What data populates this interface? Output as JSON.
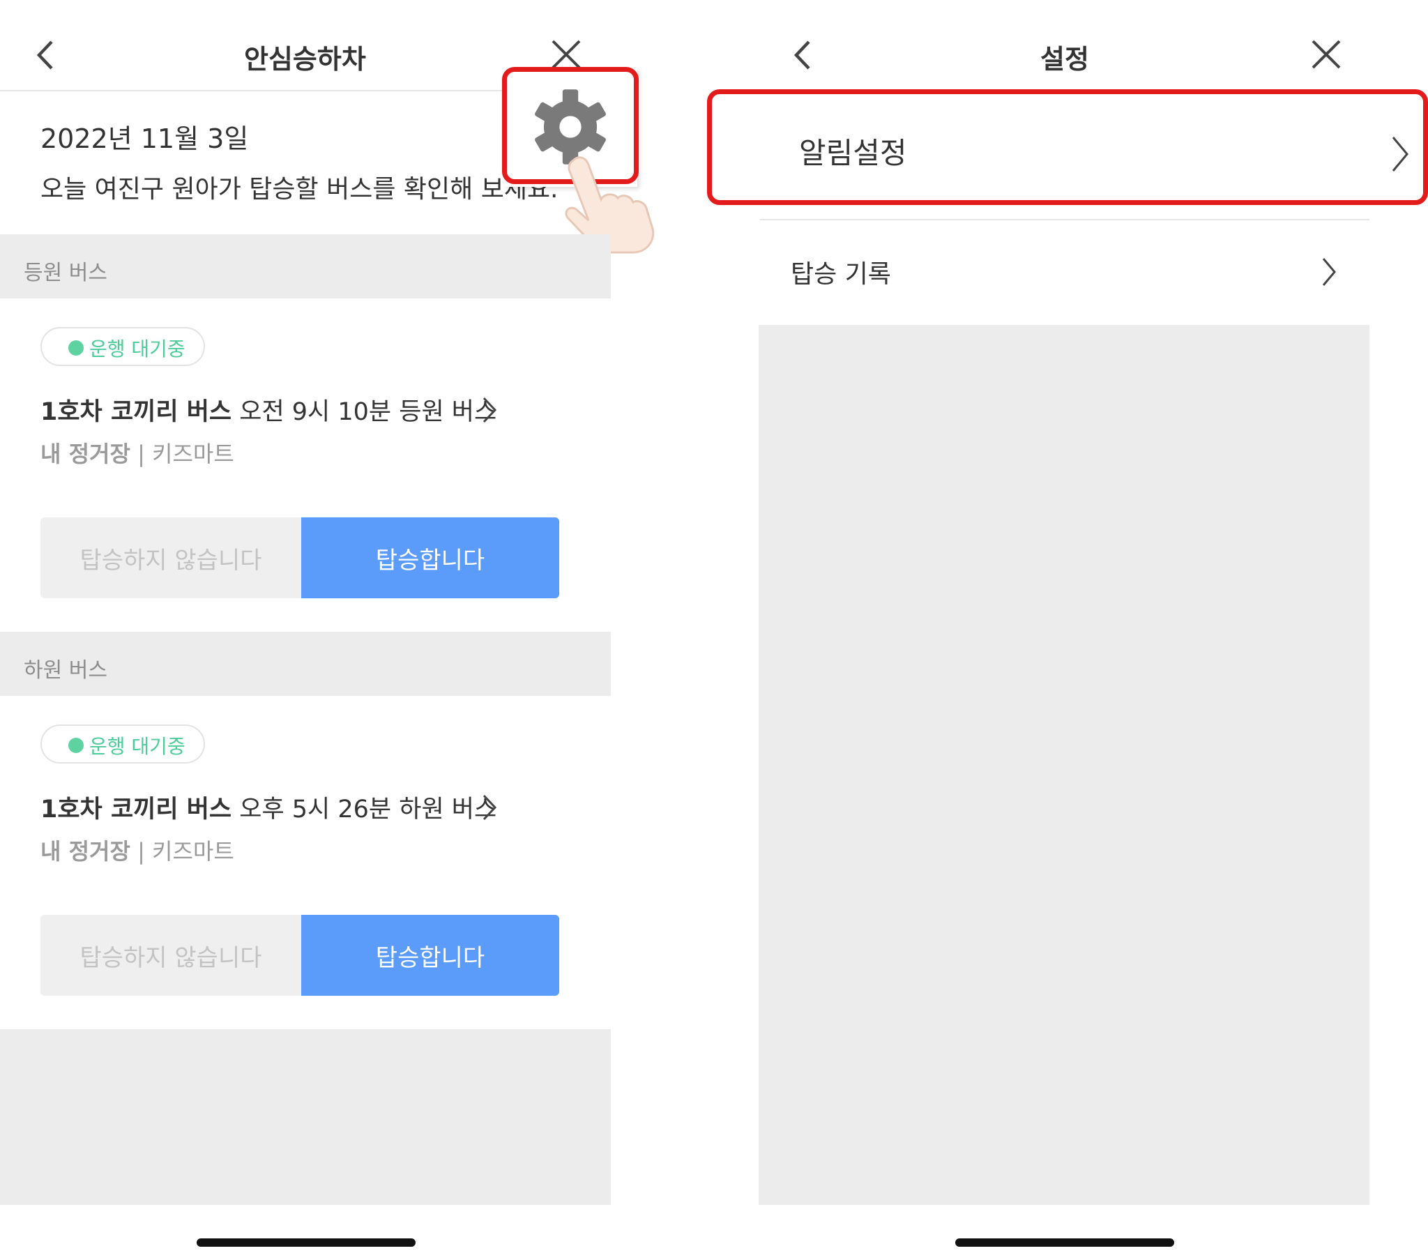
{
  "left_screen": {
    "header": {
      "title": "안심승하차",
      "back_icon": "chevron-left-icon",
      "close_icon": "close-icon"
    },
    "settings_icon": "gear-icon",
    "intro": {
      "date": "2022년 11월 3일",
      "message": "오늘 여진구 원아가 탑승할 버스를 확인해 보세요."
    },
    "sections": [
      {
        "label": "등원 버스",
        "status": "운행 대기중",
        "bus_name": "1호차 코끼리 버스",
        "bus_time": "오전 9시 10분 등원 버스",
        "stop_label": "내 정거장",
        "stop_separator": "|",
        "stop_name": "키즈마트",
        "decline_label": "탑승하지 않습니다",
        "accept_label": "탑승합니다"
      },
      {
        "label": "하원 버스",
        "status": "운행 대기중",
        "bus_name": "1호차 코끼리 버스",
        "bus_time": "오후 5시 26분 하원 버스",
        "stop_label": "내 정거장",
        "stop_separator": "|",
        "stop_name": "키즈마트",
        "decline_label": "탑승하지 않습니다",
        "accept_label": "탑승합니다"
      }
    ]
  },
  "right_screen": {
    "header": {
      "title": "설정",
      "back_icon": "chevron-left-icon",
      "close_icon": "close-icon"
    },
    "menu": [
      {
        "label": "알림설정",
        "icon": "chevron-right-icon"
      },
      {
        "label": "탑승 기록",
        "icon": "chevron-right-icon"
      }
    ]
  },
  "colors": {
    "highlight_red": "#e31b1b",
    "accept_blue": "#5b9cfb",
    "status_green": "#4ccc98",
    "section_gray": "#ececec"
  }
}
